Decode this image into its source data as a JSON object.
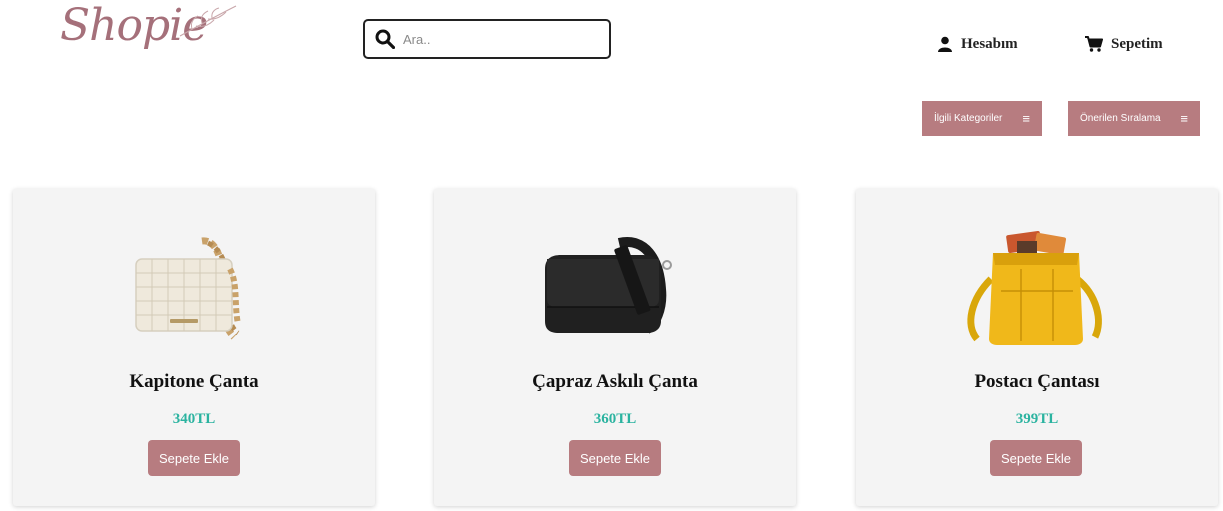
{
  "header": {
    "logo_text": "Shopie",
    "search": {
      "placeholder": "Ara..",
      "value": ""
    },
    "account_label": "Hesabım",
    "cart_label": "Sepetim"
  },
  "filters": {
    "related_categories_label": "İlgili Kategoriler",
    "sort_label": "Önerilen Sıralama"
  },
  "products": [
    {
      "name": "Kapitone Çanta",
      "price": "340TL",
      "button_label": "Sepete Ekle",
      "image": "quilted-cream-bag-with-chain"
    },
    {
      "name": "Çapraz Askılı Çanta",
      "price": "360TL",
      "button_label": "Sepete Ekle",
      "image": "black-crossbody-bag"
    },
    {
      "name": "Postacı Çantası",
      "price": "399TL",
      "button_label": "Sepete Ekle",
      "image": "yellow-messenger-bag"
    }
  ],
  "colors": {
    "brand": "#a5707a",
    "button": "#b77c80",
    "price": "#2bb3a0",
    "card_bg": "#f4f4f4"
  }
}
